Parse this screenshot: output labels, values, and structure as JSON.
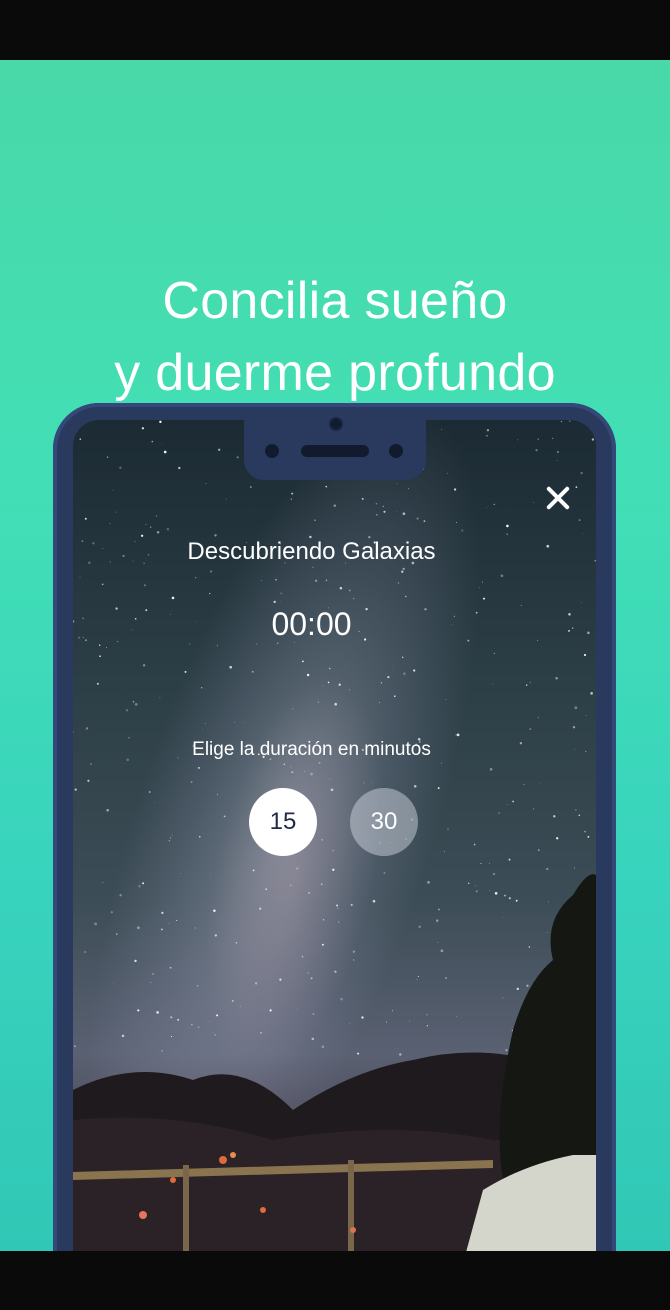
{
  "promo": {
    "headline_line1": "Concilia sueño",
    "headline_line2": "y duerme profundo"
  },
  "player": {
    "track_title": "Descubriendo Galaxias",
    "timer": "00:00",
    "duration_label": "Elige la duración en minutos",
    "options": [
      "15",
      "30"
    ],
    "selected_option": "15"
  },
  "icons": {
    "close": "close-icon"
  },
  "colors": {
    "background_top": "#49d8a8",
    "background_bottom": "#31c7b6",
    "phone_frame": "#2a3a5e",
    "selected_chip": "#ffffff",
    "selected_text": "#1f2a44"
  }
}
